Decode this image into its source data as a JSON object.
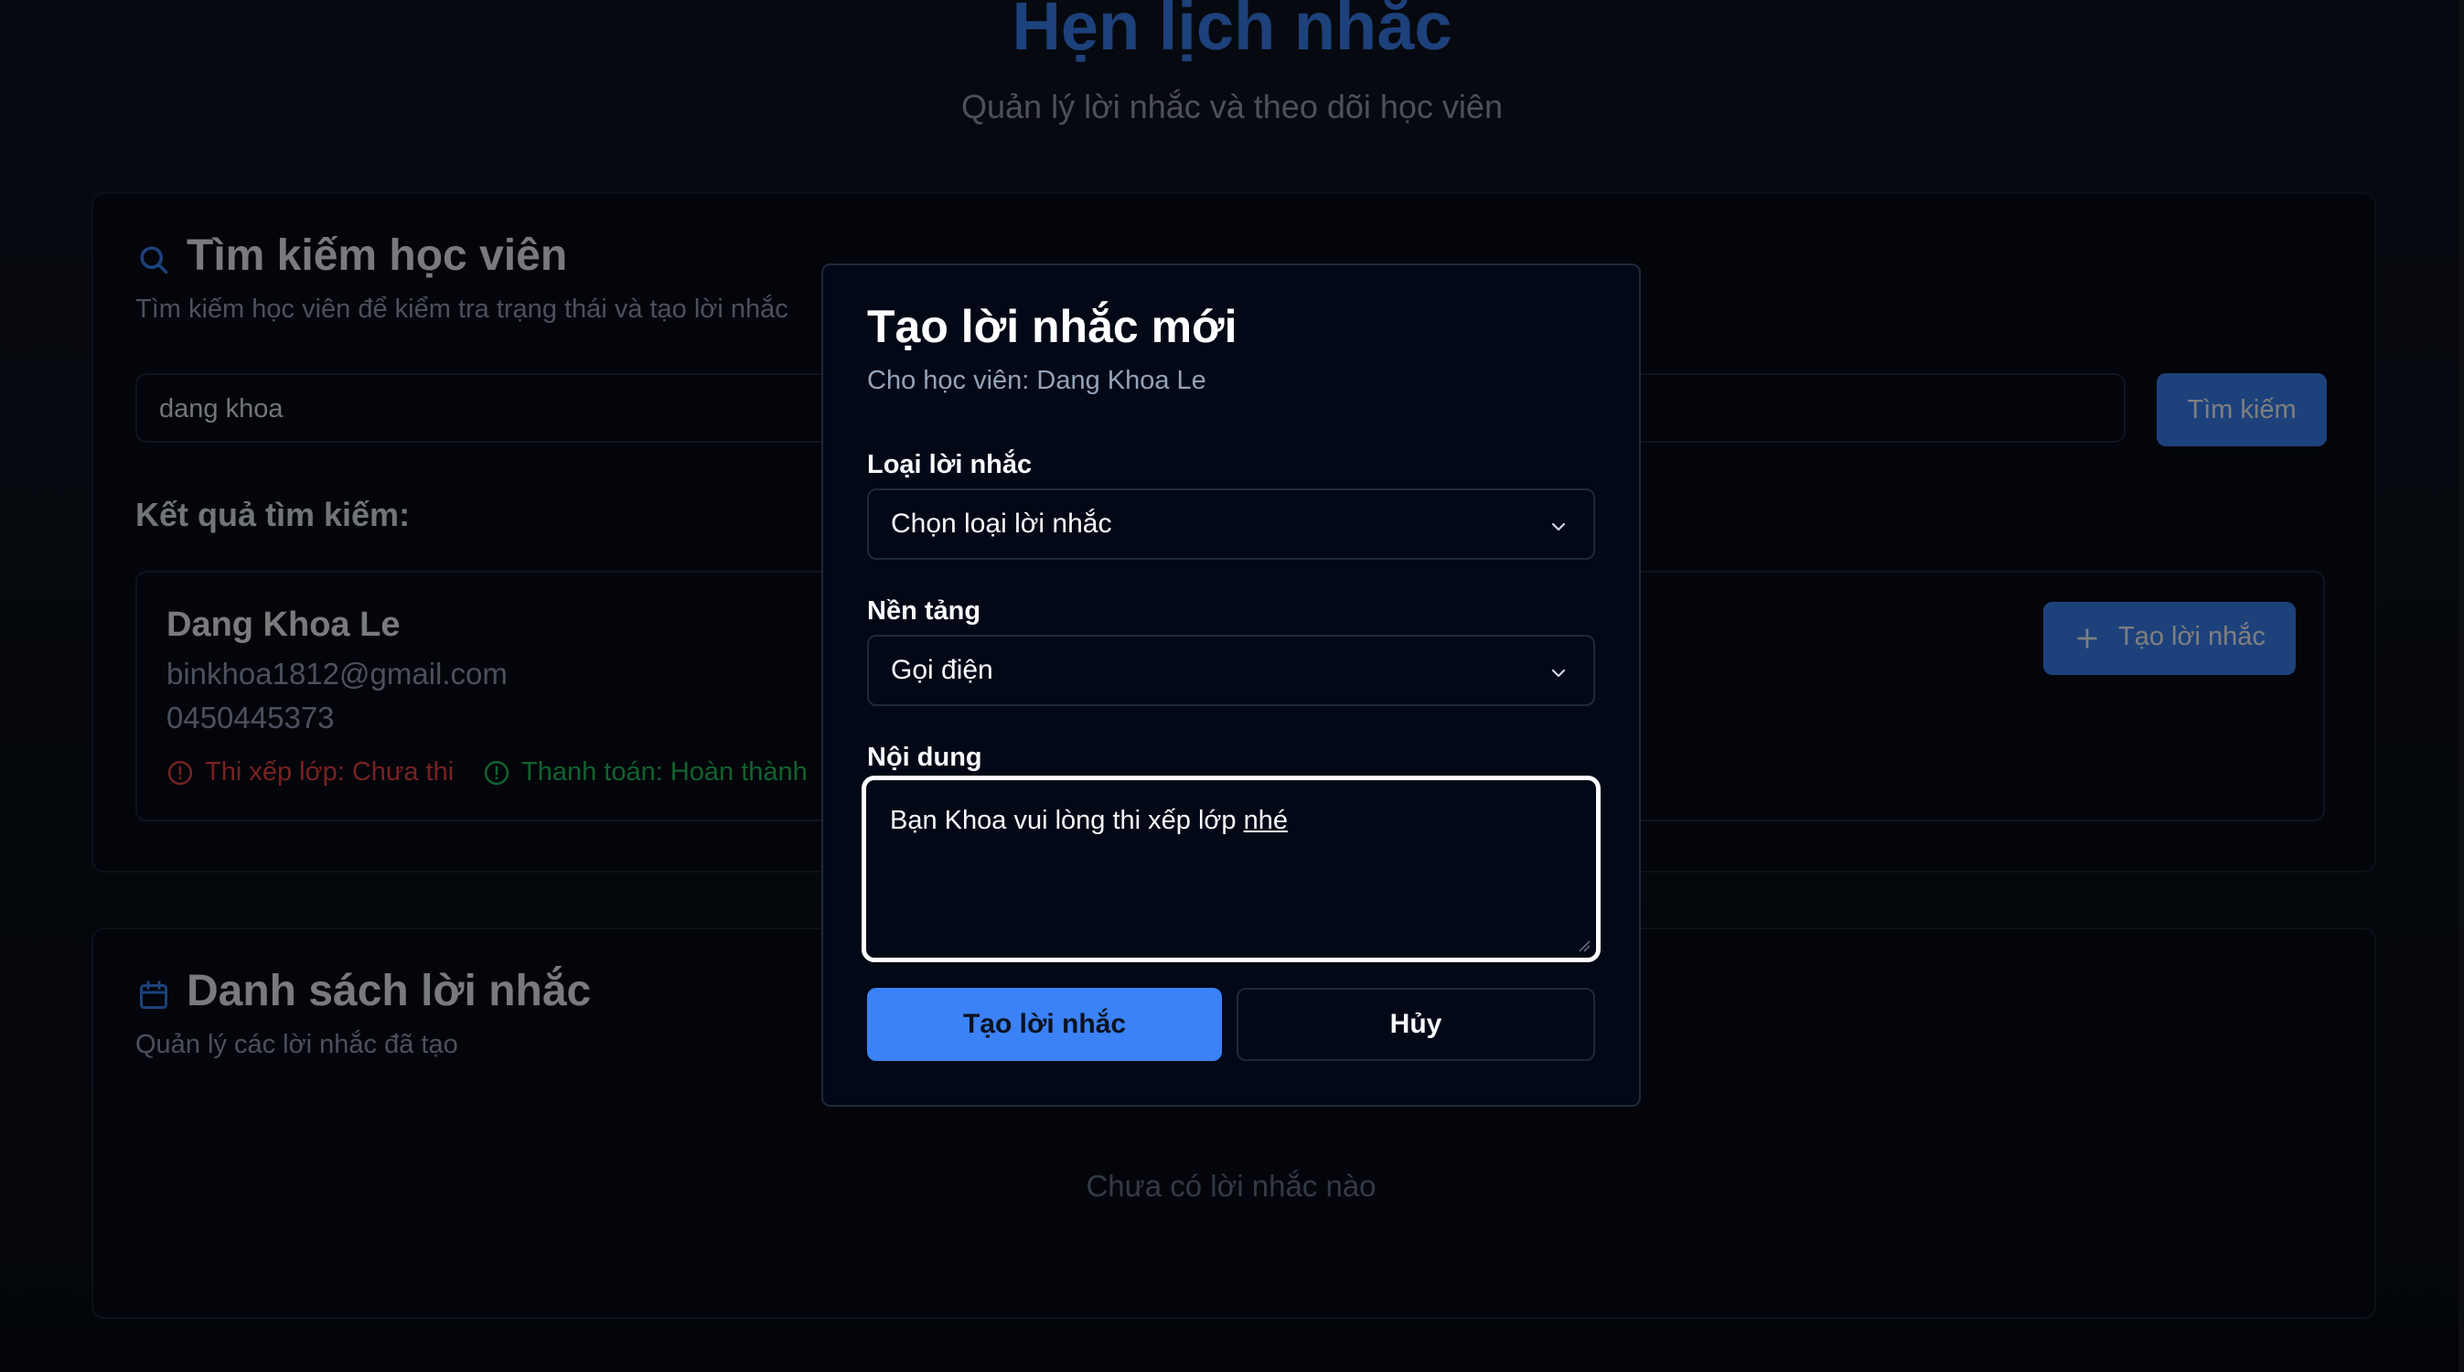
{
  "page": {
    "title": "Hẹn lịch nhắc",
    "subtitle": "Quản lý lời nhắc và theo dõi học viên"
  },
  "search_card": {
    "icon": "search-icon",
    "title": "Tìm kiếm học viên",
    "description": "Tìm kiếm học viên để kiểm tra trạng thái và tạo lời nhắc",
    "input_value": "dang khoa",
    "search_button": "Tìm kiếm",
    "results_label": "Kết quả tìm kiếm:"
  },
  "result": {
    "name": "Dang Khoa Le",
    "email": "binkhoa1812@gmail.com",
    "phone": "0450445373",
    "status_placement": "Thi xếp lớp: Chưa thi",
    "status_payment": "Thanh toán: Hoàn thành",
    "create_button": "Tạo lời nhắc"
  },
  "reminders_card": {
    "icon": "calendar-icon",
    "title": "Danh sách lời nhắc",
    "description": "Quản lý các lời nhắc đã tạo",
    "empty_text": "Chưa có lời nhắc nào"
  },
  "modal": {
    "title": "Tạo lời nhắc mới",
    "subtitle": "Cho học viên: Dang Khoa Le",
    "type_label": "Loại lời nhắc",
    "type_value": "Chọn loại lời nhắc",
    "platform_label": "Nền tảng",
    "platform_value": "Gọi điện",
    "content_label": "Nội dung",
    "content_value_main": "Bạn Khoa vui lòng thi xếp lớp ",
    "content_value_underlined": "nhé",
    "submit_button": "Tạo lời nhắc",
    "cancel_button": "Hủy"
  },
  "colors": {
    "accent": "#3b82f6",
    "background": "#070b14",
    "status_error": "#ef4444",
    "status_success": "#22c55e"
  }
}
